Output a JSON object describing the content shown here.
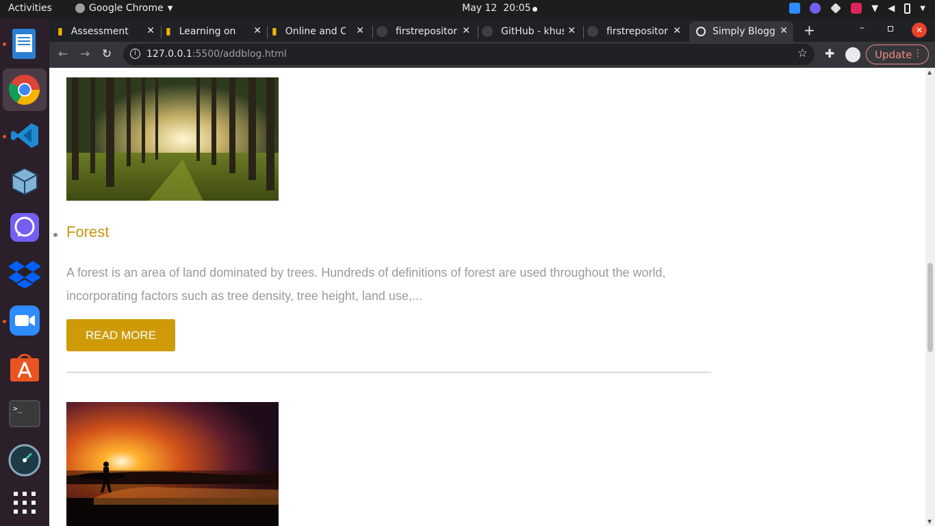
{
  "topbar": {
    "activities": "Activities",
    "app_name": "Google Chrome",
    "date": "May 12",
    "time": "20:05"
  },
  "dock": {
    "items": [
      "libreoffice-writer",
      "google-chrome",
      "vscode",
      "virtualbox",
      "viber",
      "dropbox",
      "zoom",
      "ubuntu-software",
      "terminal",
      "stacer",
      "show-apps"
    ]
  },
  "tabs": [
    {
      "title": "Assessment",
      "icon": "bar-chart-icon"
    },
    {
      "title": "Learning on S",
      "icon": "bar-chart-icon"
    },
    {
      "title": "Online and C",
      "icon": "bar-chart-icon"
    },
    {
      "title": "firstrepositor",
      "icon": "github-icon"
    },
    {
      "title": "GitHub - khus",
      "icon": "github-icon"
    },
    {
      "title": "firstrepositor",
      "icon": "github-icon"
    },
    {
      "title": "Simply Blogg",
      "icon": "globe-icon"
    }
  ],
  "toolbar": {
    "url_host": "127.0.0.1",
    "url_path": ":5500/addblog.html",
    "update_label": "Update"
  },
  "page": {
    "post": {
      "title": "Forest",
      "excerpt": "A forest is an area of land dominated by trees. Hundreds of definitions of forest are used throughout the world, incorporating factors such as tree density, tree height, land use,...",
      "button": "READ MORE"
    }
  },
  "colors": {
    "accent": "#cf9a08",
    "title": "#c8960a",
    "text_muted": "#9a9a9a"
  }
}
